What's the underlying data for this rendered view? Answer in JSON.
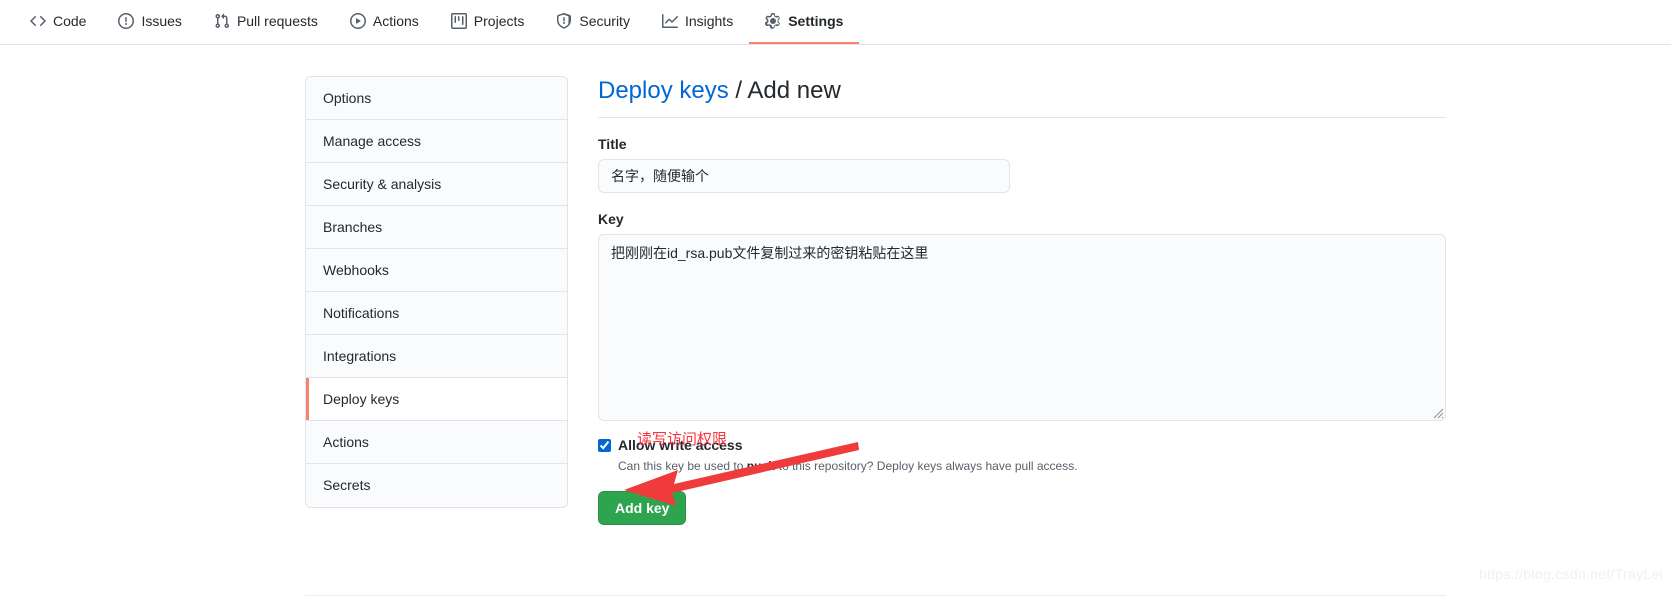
{
  "nav": {
    "items": [
      {
        "label": "Code",
        "icon": "code-icon",
        "active": false
      },
      {
        "label": "Issues",
        "icon": "issue-opened-icon",
        "active": false
      },
      {
        "label": "Pull requests",
        "icon": "git-pull-request-icon",
        "active": false
      },
      {
        "label": "Actions",
        "icon": "play-icon",
        "active": false
      },
      {
        "label": "Projects",
        "icon": "project-board-icon",
        "active": false
      },
      {
        "label": "Security",
        "icon": "shield-icon",
        "active": false
      },
      {
        "label": "Insights",
        "icon": "graph-icon",
        "active": false
      },
      {
        "label": "Settings",
        "icon": "gear-icon",
        "active": true
      }
    ]
  },
  "sidebar": {
    "items": [
      {
        "label": "Options",
        "active": false
      },
      {
        "label": "Manage access",
        "active": false
      },
      {
        "label": "Security & analysis",
        "active": false
      },
      {
        "label": "Branches",
        "active": false
      },
      {
        "label": "Webhooks",
        "active": false
      },
      {
        "label": "Notifications",
        "active": false
      },
      {
        "label": "Integrations",
        "active": false
      },
      {
        "label": "Deploy keys",
        "active": true
      },
      {
        "label": "Actions",
        "active": false
      },
      {
        "label": "Secrets",
        "active": false
      }
    ]
  },
  "main": {
    "title_link": "Deploy keys",
    "title_separator": " / ",
    "title_current": "Add new",
    "title_label": "Title",
    "title_value": "名字，随便输个",
    "title_placeholder": "",
    "key_label": "Key",
    "key_value": "把刚刚在id_rsa.pub文件复制过来的密钥粘贴在这里",
    "key_placeholder": "",
    "checkbox_label": "Allow write access",
    "checkbox_checked": true,
    "help_before": "Can this key be used to ",
    "help_bold": "push",
    "help_after": " to this repository? Deploy keys always have pull access.",
    "submit_label": "Add key"
  },
  "annotations": {
    "red_note": "读写访问权限",
    "red_color": "#f5333f",
    "arrow_name": "red-arrow-pointing-to-checkbox"
  },
  "watermark": {
    "text": "https://blog.csdn.net/TrayLei"
  },
  "colors": {
    "accent_tab_underline": "#f9826c",
    "link_blue": "#0366d6",
    "button_green": "#2ea44f",
    "checkbox_blue": "#0366d6",
    "border": "#e1e4e8",
    "field_bg": "#fafbfc"
  }
}
